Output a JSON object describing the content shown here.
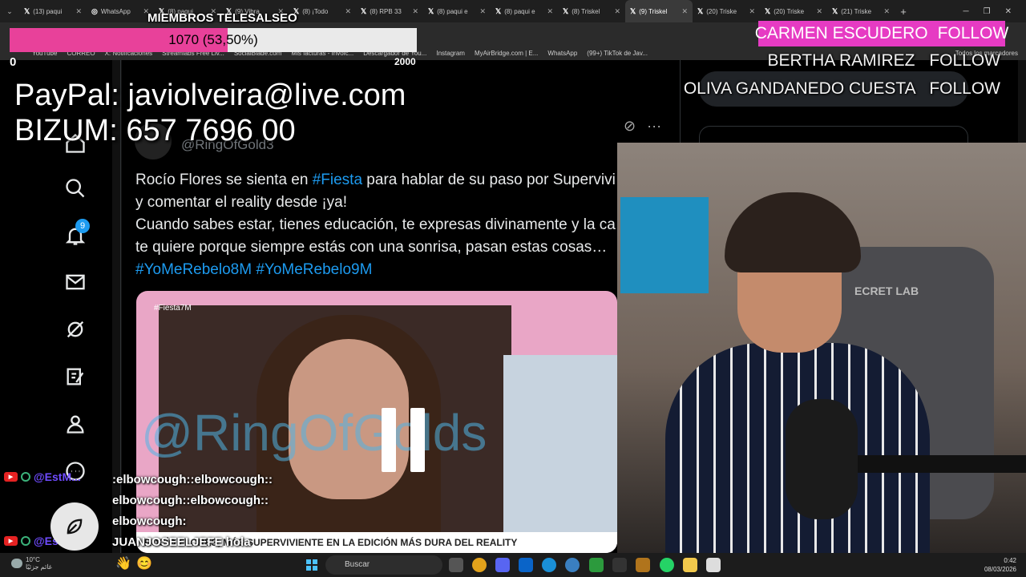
{
  "browser": {
    "tabs": [
      {
        "label": "(13) paqui",
        "icon": "X"
      },
      {
        "label": "WhatsApp",
        "icon": "globe"
      },
      {
        "label": "(8) paqui",
        "icon": "X"
      },
      {
        "label": "(9) Vibra",
        "icon": "X"
      },
      {
        "label": "(8) ¡Todo",
        "icon": "X"
      },
      {
        "label": "(8) RPB 33",
        "icon": "X"
      },
      {
        "label": "(8) paqui e",
        "icon": "X"
      },
      {
        "label": "(8) paqui e",
        "icon": "X"
      },
      {
        "label": "(8) Triskel",
        "icon": "X"
      },
      {
        "label": "(9) Triskel",
        "icon": "X",
        "active": true
      },
      {
        "label": "(20) Triske",
        "icon": "X"
      },
      {
        "label": "(20) Triske",
        "icon": "X"
      },
      {
        "label": "(21) Triske",
        "icon": "X"
      }
    ],
    "bookmarks": [
      "YouTube",
      "CORREO",
      "X: Notificaciones",
      "Streamlabs Free Liv...",
      "SocialBlade.com",
      "Mis facturas - Invoic...",
      "Descargador de You...",
      "Instagram",
      "MyAirBridge.com | E...",
      "WhatsApp",
      "(99+) TikTok de Jav..."
    ],
    "bookmarks_right": "Todos los marcadores"
  },
  "x_page": {
    "handle": "@RingOfGold3",
    "tweet_lines": [
      [
        {
          "t": "Rocío Flores se sienta en "
        },
        {
          "t": "#Fiesta",
          "h": true
        },
        {
          "t": " para hablar de su paso por Supervivi"
        }
      ],
      [
        {
          "t": "y comentar el reality desde ¡ya!"
        }
      ],
      [
        {
          "t": "Cuando sabes estar, tienes educación, te expresas divinamente y la ca"
        }
      ],
      [
        {
          "t": "te quiere porque siempre estás con una sonrisa, pasan estas cosas…"
        }
      ],
      [
        {
          "t": "#YoMeRebelo8M",
          "h": true
        },
        {
          "t": " "
        },
        {
          "t": "#YoMeRebelo9M",
          "h": true
        }
      ]
    ],
    "media": {
      "watermark": "@RingOfGolds",
      "tag": "#Fiesta7M",
      "caption": "ROCÍO FLORES, MÁS SUPERVIVIENTE EN LA EDICIÓN MÁS DURA DEL REALITY"
    },
    "notification_count": "9"
  },
  "overlay": {
    "goal": {
      "title": "MIEMBROS TELESALSEO",
      "label": "1070 (53,50%)",
      "min": "0",
      "max": "2000",
      "current": 1070,
      "target": 2000,
      "fill_color": "#e8419a"
    },
    "paypal": "PayPal: javiolveira@live.com",
    "bizum": "BIZUM: 657 7696 00",
    "follows": [
      {
        "name": "CARMEN ESCUDERO",
        "action": "FOLLOW"
      },
      {
        "name": "BERTHA RAMIREZ",
        "action": "FOLLOW"
      },
      {
        "name": "OLIVA GANDANEDO CUESTA",
        "action": "FOLLOW"
      }
    ],
    "chat": {
      "users": [
        "@EstM...",
        "@Estel..."
      ],
      "messages": ":elbowcough::elbowcough::elbowcough::elbowcough::elbowcough:",
      "last_message": "JUANJOSEELJEFE hola"
    },
    "webcam_sign": "ECRET LAB"
  },
  "taskbar": {
    "weather_temp": "10°C",
    "weather_desc": "غائم جزئيًا",
    "search": "Buscar",
    "time": "0:42",
    "date": "08/03/2026"
  },
  "colors": {
    "x_blue": "#1d9bf0",
    "follow_bg": "#e63bc3"
  }
}
